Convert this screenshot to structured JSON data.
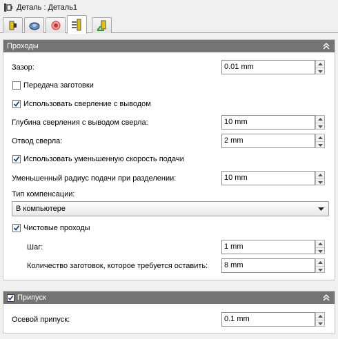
{
  "window": {
    "title": "Деталь : Деталь1"
  },
  "tabs": [
    {
      "icon": "tool-holder-icon",
      "active": false
    },
    {
      "icon": "shape-icon",
      "active": false
    },
    {
      "icon": "heights-icon",
      "active": false
    },
    {
      "icon": "passes-icon",
      "active": true
    },
    {
      "icon": "linking-icon",
      "active": false
    }
  ],
  "passes": {
    "title": "Проходы",
    "clearance_label": "Зазор:",
    "clearance_value": "0.01 mm",
    "stock_transfer_label": "Передача заготовки",
    "stock_transfer_checked": false,
    "use_drilling_label": "Использовать сверление с выводом",
    "use_drilling_checked": true,
    "pecking_depth_label": "Глубина сверления с выводом сверла:",
    "pecking_depth_value": "10 mm",
    "retract_label": "Отвод сверла:",
    "retract_value": "2 mm",
    "reduced_feed_label": "Использовать уменьшенную скорость подачи",
    "reduced_feed_checked": true,
    "reduced_radius_label": "Уменьшенный радиус подачи при разделении:",
    "reduced_radius_value": "10 mm",
    "compensation_label": "Тип компенсации:",
    "compensation_value": "В компьютере",
    "finishing_label": "Чистовые проходы",
    "finishing_checked": true,
    "step_label": "Шаг:",
    "step_value": "1 mm",
    "stock_leave_label": "Количество заготовок, которое требуется оставить:",
    "stock_leave_value": "8 mm"
  },
  "allowance": {
    "title": "Припуск",
    "enabled": true,
    "axial_label": "Осевой припуск:",
    "axial_value": "0.1 mm"
  },
  "colors": {
    "header_bg": "#747474",
    "tab_active_bg": "#ffffff",
    "check_mark": "#1a3a8a"
  }
}
